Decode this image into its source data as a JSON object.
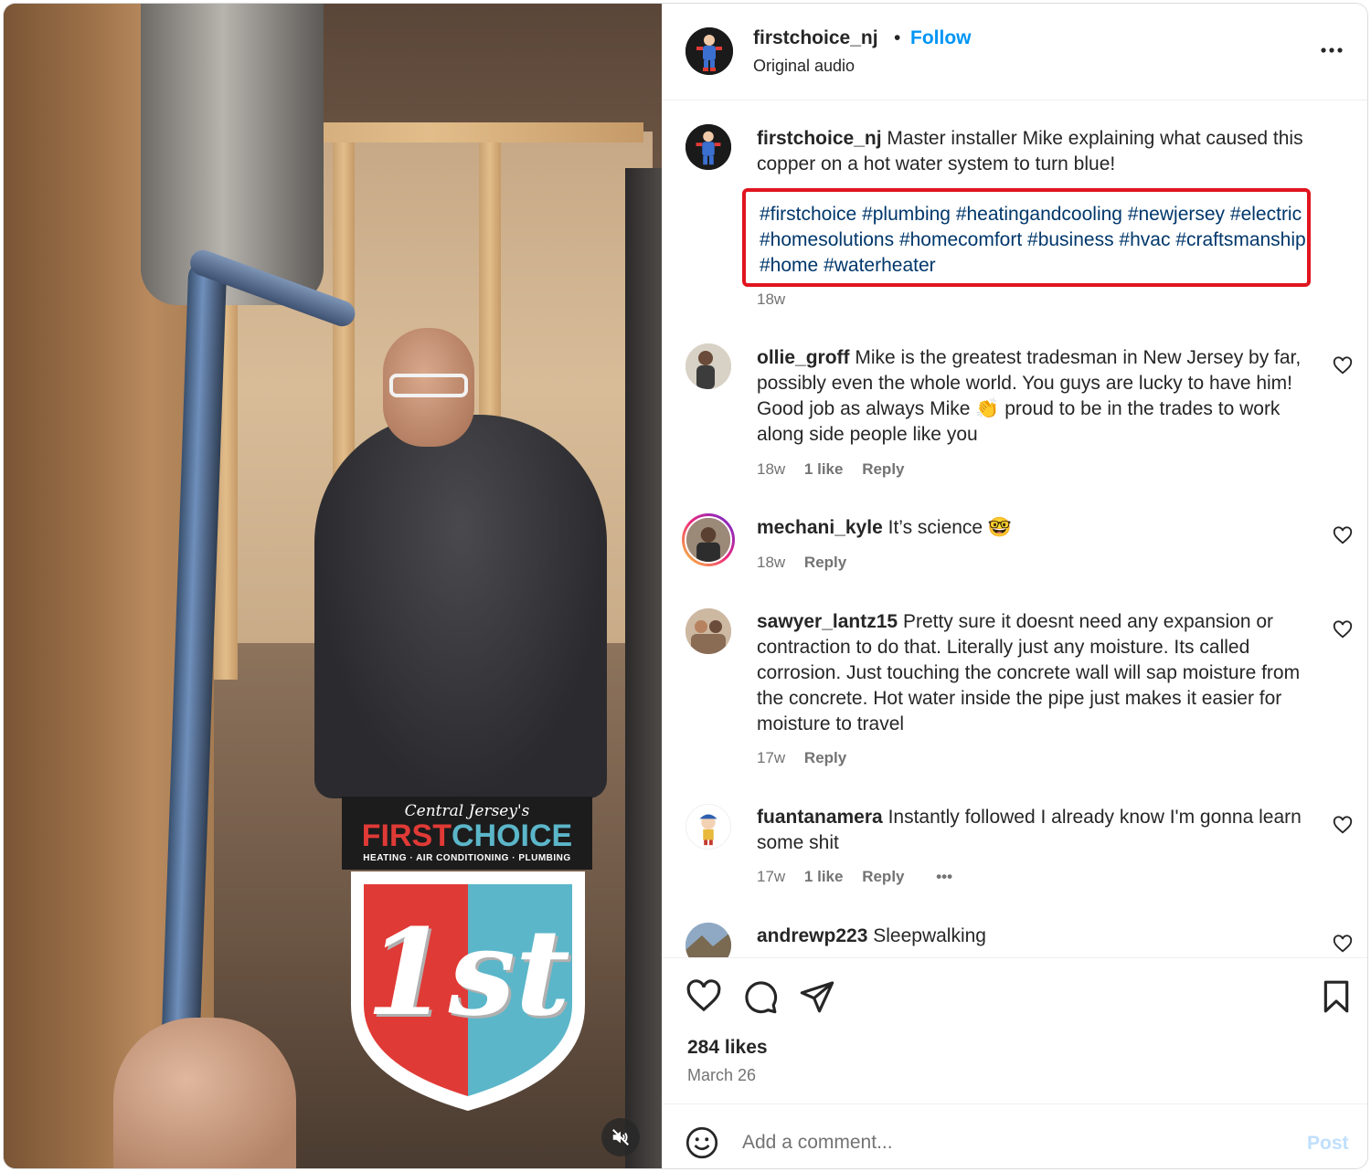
{
  "post": {
    "username": "firstchoice_nj",
    "separator": "•",
    "follow_label": "Follow",
    "audio": "Original audio",
    "caption_user": "firstchoice_nj",
    "caption_text": "Master installer Mike explaining what caused this copper on a hot water system to turn blue!",
    "hashtags": [
      "#firstchoice",
      "#plumbing",
      "#heatingandcooling",
      "#newjersey",
      "#electric",
      "#homesolutions",
      "#homecomfort",
      "#business",
      "#hvac",
      "#craftsmanship",
      "#home",
      "#waterheater"
    ],
    "caption_age": "18w"
  },
  "media": {
    "logo_script": "Central Jersey's",
    "logo_first": "FIRST",
    "logo_choice": "CHOICE",
    "logo_sub": "HEATING · AIR CONDITIONING · PLUMBING",
    "badge": "1st",
    "colors": {
      "red": "#e03a36",
      "teal": "#5bb6c9"
    }
  },
  "comments": [
    {
      "user": "ollie_groff",
      "text": "Mike is the greatest tradesman in New Jersey by far, possibly even the whole world. You guys are lucky to have him! Good job as always Mike 👏 proud to be in the trades to work along side people like you",
      "age": "18w",
      "likes": "1 like",
      "reply": "Reply"
    },
    {
      "user": "mechani_kyle",
      "text": "It’s science 🤓",
      "age": "18w",
      "reply": "Reply"
    },
    {
      "user": "sawyer_lantz15",
      "text": "Pretty sure it doesnt need any expansion or contraction to do that. Literally just any moisture. Its called corrosion. Just touching the concrete wall will sap moisture from the concrete. Hot water inside the pipe just makes it easier for moisture to travel",
      "age": "17w",
      "reply": "Reply"
    },
    {
      "user": "fuantanamera",
      "text": "Instantly followed I already know I'm gonna learn some shit",
      "age": "17w",
      "likes": "1 like",
      "reply": "Reply",
      "more": "•••"
    },
    {
      "user": "andrewp223",
      "text": "Sleepwalking"
    }
  ],
  "footer": {
    "likes": "284 likes",
    "date": "March 26",
    "comment_placeholder": "Add a comment...",
    "post_label": "Post"
  },
  "colors": {
    "link": "#0095f6",
    "hashtag": "#00376b",
    "highlight_box": "#e0151f",
    "muted": "#737373"
  }
}
